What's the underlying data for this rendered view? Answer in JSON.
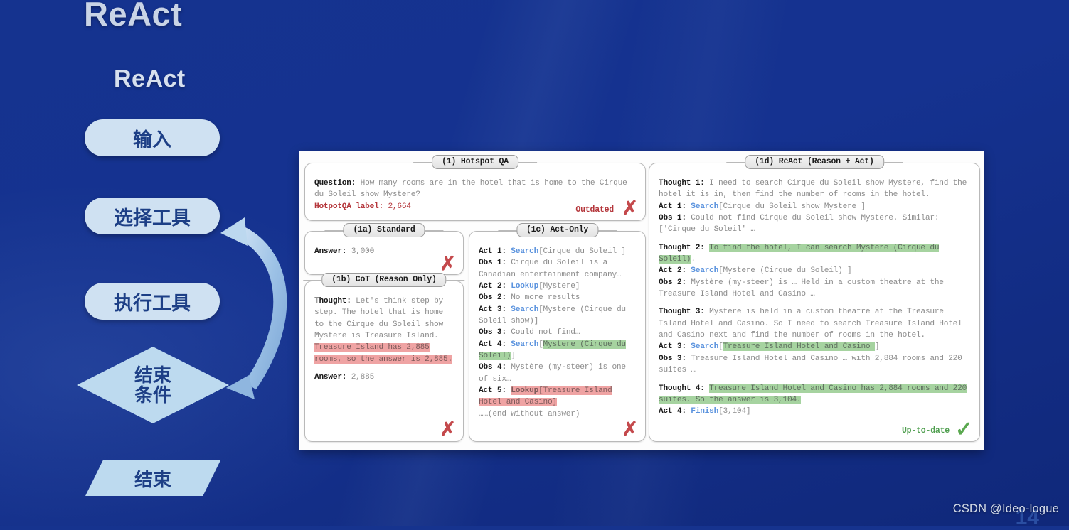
{
  "slide": {
    "title": "ReAct",
    "watermark": "CSDN @Ideo-logue",
    "page_number": "14",
    "background_color": "#16338e"
  },
  "flowchart": {
    "title": "ReAct",
    "node_color": "#cfe1f2",
    "text_color": "#1d3f86",
    "nodes": [
      {
        "label": "输入",
        "shape": "pill"
      },
      {
        "label": "选择工具",
        "shape": "pill"
      },
      {
        "label": "执行工具",
        "shape": "pill"
      },
      {
        "label_line1": "结束",
        "label_line2": "条件",
        "shape": "diamond"
      },
      {
        "label": "结束",
        "shape": "parallelogram"
      }
    ],
    "loop_arrow": "curved-loop-arrow"
  },
  "figure": {
    "panels": {
      "qa": {
        "tab": "(1) Hotspot QA",
        "question_label": "Question:",
        "question_text": " How many rooms are in the hotel that is home to the Cirque du Soleil show Mystere?",
        "label_key": "HotpotQA label:",
        "label_value": "2,664",
        "status": "Outdated",
        "mark": "✗"
      },
      "standard": {
        "tab": "(1a) Standard",
        "answer_label": "Answer:",
        "answer_value": "3,000",
        "mark": "✗"
      },
      "cot": {
        "tab": "(1b) CoT (Reason Only)",
        "thought_label": "Thought:",
        "thought_plain": " Let's think step by step. The hotel that is home to the Cirque du Soleil show Mystere is Treasure Island. ",
        "thought_highlight": "Treasure Island has 2,885 rooms, so the answer is 2,885.",
        "answer_label": "Answer:",
        "answer_value": "2,885",
        "mark": "✗"
      },
      "act": {
        "tab": "(1c) Act-Only",
        "steps": [
          {
            "label": "Act 1:",
            "action": "Search",
            "plain": "[Cirque du Soleil ]"
          },
          {
            "label": "Obs 1:",
            "plain": " Cirque du Soleil is a Canadian entertainment company…"
          },
          {
            "label": "Act 2:",
            "action": "Lookup",
            "plain": "[Mystere]"
          },
          {
            "label": "Obs 2:",
            "plain": " No more results"
          },
          {
            "label": "Act 3:",
            "action": "Search",
            "plain": "[Mystere (Cirque du Soleil show)]"
          },
          {
            "label": "Obs 3:",
            "plain": " Could not find…"
          },
          {
            "label": "Act 4:",
            "action": "Search",
            "bracket_open": "[",
            "highlight_green": "Mystere (Cirque du Soleil)",
            "bracket_close": "]"
          },
          {
            "label": "Obs 4:",
            "plain": " Mystère (my-steer)  is one of six…"
          },
          {
            "label": "Act 5:",
            "action_pink": "Lookup",
            "highlight_pink": "[Treasure Island Hotel and Casino]"
          },
          {
            "label": "",
            "plain": "……(end without answer)"
          }
        ],
        "mark": "✗"
      },
      "react": {
        "tab": "(1d) ReAct (Reason + Act)",
        "steps": [
          {
            "label": "Thought 1:",
            "plain": " I need to search Cirque du Soleil show Mystere, find the hotel it is in, then find the number of rooms in the hotel."
          },
          {
            "label": "Act 1:",
            "action": "Search",
            "plain": "[Cirque du Soleil show Mystere ]"
          },
          {
            "label": "Obs 1:",
            "plain": " Could not find Cirque du Soleil show Mystere. Similar: ['Cirque du Soleil' …"
          },
          {
            "label": "Thought 2:",
            "highlight_green": "To find the hotel, I can search Mystere (Cirque du Soleil)",
            "plain_after": "."
          },
          {
            "label": "Act 2:",
            "action": "Search",
            "plain": "[Mystere (Cirque du Soleil) ]"
          },
          {
            "label": "Obs 2:",
            "plain": " Mystère (my-steer)  is …  Held in a custom theatre at the Treasure Island Hotel and Casino …"
          },
          {
            "label": "Thought 3:",
            "plain": " Mystere is held in a custom theatre at the Treasure Island Hotel and Casino. So I need to search Treasure Island Hotel and Casino next and find the number of rooms in the hotel."
          },
          {
            "label": "Act 3:",
            "action": "Search",
            "bracket_open": "[",
            "highlight_green": "Treasure Island Hotel and Casino ",
            "bracket_close": "]"
          },
          {
            "label": "Obs 3:",
            "plain": " Treasure Island Hotel and Casino …  with 2,884 rooms and 220 suites …"
          },
          {
            "label": "Thought 4:",
            "highlight_green": "Treasure Island Hotel and Casino has 2,884 rooms and 220 suites. So the answer is 3,104."
          },
          {
            "label": "Act 4:",
            "action": "Finish",
            "plain": "[3,104]"
          }
        ],
        "status": "Up-to-date",
        "mark": "✓"
      }
    },
    "colors": {
      "highlight_green": "#a6d3a0",
      "highlight_pink": "#efa3a3",
      "action_blue": "#5b93de",
      "error_red": "#c4494c",
      "success_green": "#5aa84f"
    }
  }
}
